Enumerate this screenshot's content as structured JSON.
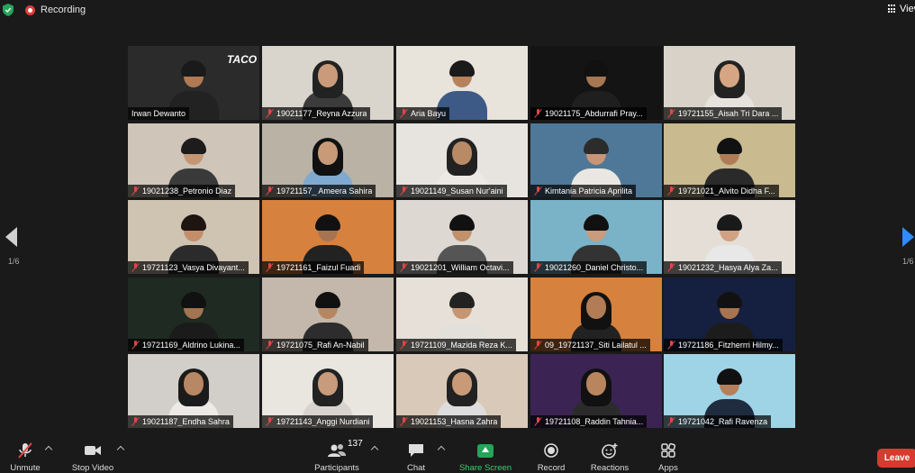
{
  "top_bar": {
    "recording_label": "Recording",
    "view_label": "View"
  },
  "pagination": {
    "left_page": "1/6",
    "right_page": "1/6"
  },
  "participants": [
    {
      "name": "Irwan Dewanto",
      "muted": false,
      "bg": "#2b2b2b",
      "skin": "#b07a55",
      "hair": "#1a1a1a",
      "shirt": "#222",
      "hijab": false,
      "logo": "TACO",
      "active": true
    },
    {
      "name": "19021177_Reyna Azzura",
      "muted": true,
      "bg": "#d9d4cc",
      "skin": "#c99b7a",
      "hair": "#222",
      "shirt": "#3b3b3b",
      "hijab": true
    },
    {
      "name": "Aria Bayu",
      "muted": true,
      "bg": "#e8e3db",
      "skin": "#b5825c",
      "hair": "#1a1a1a",
      "shirt": "#3d5a86",
      "hijab": false
    },
    {
      "name": "19021175_Abdurrafi Pray...",
      "muted": true,
      "bg": "#141414",
      "skin": "#a77652",
      "hair": "#111",
      "shirt": "#1f1f1f",
      "hijab": false
    },
    {
      "name": "19721155_Aisah Tri Dara ...",
      "muted": true,
      "bg": "#d8d2c8",
      "skin": "#d6a583",
      "hair": "#222",
      "shirt": "#e6e2dc",
      "hijab": true
    },
    {
      "name": "19021238_Petronio Diaz",
      "muted": true,
      "bg": "#cfc5b8",
      "skin": "#c59674",
      "hair": "#1c1c1c",
      "shirt": "#3a3a3a",
      "hijab": false
    },
    {
      "name": "19721157_ Ameera Sahira",
      "muted": true,
      "bg": "#b9b2a5",
      "skin": "#c89a78",
      "hair": "#111",
      "shirt": "#7fa9cf",
      "hijab": true
    },
    {
      "name": "19021149_Susan Nur'aini",
      "muted": true,
      "bg": "#e7e4e0",
      "skin": "#b98a66",
      "hair": "#222",
      "shirt": "#ece9e5",
      "hijab": true
    },
    {
      "name": "Kimtania Patricia Aprilita",
      "muted": true,
      "bg": "#4f7898",
      "skin": "#c79677",
      "hair": "#2c2c2c",
      "shirt": "#eae7e2",
      "hijab": false
    },
    {
      "name": "19721021_Alvito Didha F...",
      "muted": true,
      "bg": "#c9ba8f",
      "skin": "#b07c58",
      "hair": "#111",
      "shirt": "#2a2a2a",
      "hijab": false
    },
    {
      "name": "19721123_Vasya Divayant...",
      "muted": true,
      "bg": "#cfc3b2",
      "skin": "#c48e6a",
      "hair": "#1e1410",
      "shirt": "#2b2b2b",
      "hijab": false
    },
    {
      "name": "19721161_Faizul Fuadi",
      "muted": true,
      "bg": "#d6813e",
      "skin": "#a77351",
      "hair": "#111",
      "shirt": "#222",
      "hijab": false
    },
    {
      "name": "19021201_William Octavi...",
      "muted": true,
      "bg": "#ddd8d2",
      "skin": "#c29069",
      "hair": "#111",
      "shirt": "#555",
      "hijab": false
    },
    {
      "name": "19021260_Daniel Christo...",
      "muted": true,
      "bg": "#7ab2c8",
      "skin": "#c89c7c",
      "hair": "#111",
      "shirt": "#333",
      "hijab": false
    },
    {
      "name": "19021232_Hasya Alya Za...",
      "muted": true,
      "bg": "#e4ded6",
      "skin": "#d0a283",
      "hair": "#1a1a1a",
      "shirt": "#e8e8e8",
      "hijab": false
    },
    {
      "name": "19721169_Aldrino Lukina...",
      "muted": true,
      "bg": "#1f2a22",
      "skin": "#a37451",
      "hair": "#111",
      "shirt": "#1b1b1b",
      "hijab": false
    },
    {
      "name": "19721075_Rafi An-Nabil",
      "muted": true,
      "bg": "#c3b8ab",
      "skin": "#b68660",
      "hair": "#111",
      "shirt": "#2d2d2d",
      "hijab": false
    },
    {
      "name": "19721109_Mazida Reza K...",
      "muted": true,
      "bg": "#e6e0d8",
      "skin": "#c49672",
      "hair": "#222",
      "shirt": "#e3e0dc",
      "hijab": false
    },
    {
      "name": "09_19721137_Siti Lailatul ...",
      "muted": true,
      "bg": "#d6813e",
      "skin": "#b27d56",
      "hair": "#111",
      "shirt": "#222",
      "hijab": true
    },
    {
      "name": "19721186_Fitzherrri Hilmy...",
      "muted": true,
      "bg": "#152040",
      "skin": "#a87450",
      "hair": "#111",
      "shirt": "#1c1c1c",
      "hijab": false
    },
    {
      "name": "19021187_Endha Sahra",
      "muted": true,
      "bg": "#d2cfca",
      "skin": "#b88763",
      "hair": "#1b1b1b",
      "shirt": "#ece9e6",
      "hijab": true
    },
    {
      "name": "19721143_Anggi Nurdiani",
      "muted": true,
      "bg": "#e9e6e0",
      "skin": "#c79b7b",
      "hair": "#222",
      "shirt": "#d8d3cd",
      "hijab": true
    },
    {
      "name": "19021153_Hasna Zahra",
      "muted": true,
      "bg": "#d9c9b9",
      "skin": "#c89a77",
      "hair": "#222",
      "shirt": "#ddd",
      "hijab": true
    },
    {
      "name": "19721108_Raddin Tahnia...",
      "muted": true,
      "bg": "#3b2453",
      "skin": "#b8855f",
      "hair": "#111",
      "shirt": "#2b2b2b",
      "hijab": true
    },
    {
      "name": "19721042_Rafi Ravenza",
      "muted": true,
      "bg": "#9fd3e6",
      "skin": "#b3805b",
      "hair": "#111",
      "shirt": "#1f2b3f",
      "hijab": false
    }
  ],
  "toolbar": {
    "unmute": "Unmute",
    "stop_video": "Stop Video",
    "participants": "Participants",
    "participants_count": "137",
    "chat": "Chat",
    "share_screen": "Share Screen",
    "record": "Record",
    "reactions": "Reactions",
    "apps": "Apps",
    "leave": "Leave"
  }
}
